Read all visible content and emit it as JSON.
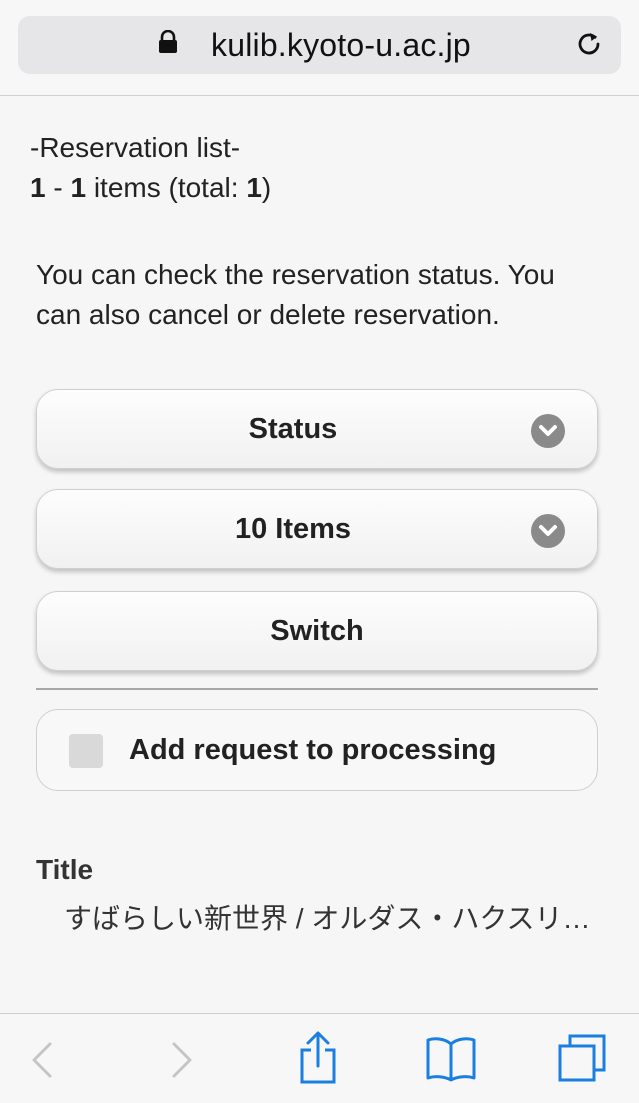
{
  "browser": {
    "url": "kulib.kyoto-u.ac.jp",
    "icons": {
      "lock": "lock-icon",
      "reload": "reload-icon"
    }
  },
  "reservations": {
    "heading": "-Reservation list-",
    "count": {
      "start": "1",
      "sep": " - ",
      "end": "1",
      "mid": " items (total: ",
      "total": "1",
      "close": ")"
    },
    "description": "You can check the reservation status. You can also cancel or delete reservation.",
    "status_select": "Status",
    "items_select": "10 Items",
    "switch_label": "Switch",
    "add_request_label": "Add request to processing",
    "title_label": "Title",
    "title_value": "すばらしい新世界 / オルダス・ハクスリ…"
  },
  "toolbar": {
    "icons": [
      "back-icon",
      "forward-icon",
      "share-icon",
      "bookmarks-icon",
      "tabs-icon"
    ],
    "accent": "#1a7fe0",
    "disabled": "#c5c5c5"
  }
}
